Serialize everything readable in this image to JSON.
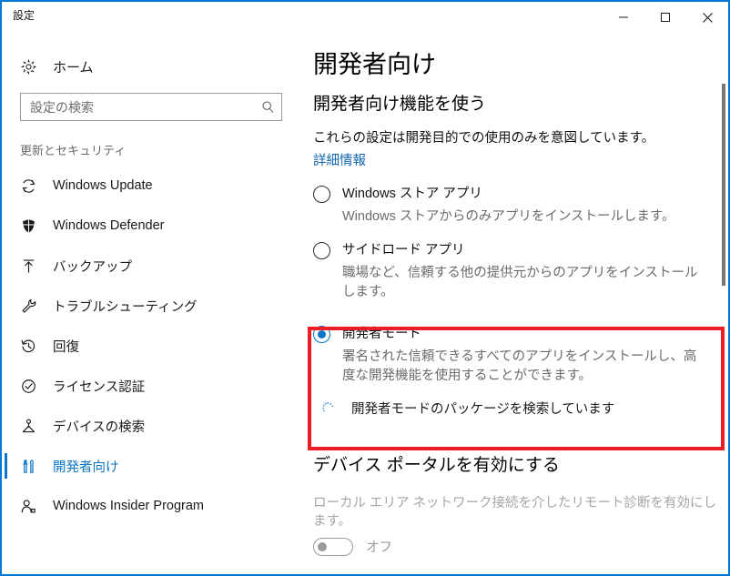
{
  "window": {
    "title": "設定",
    "accent_color": "#0078d7",
    "controls": [
      {
        "name": "minimize",
        "glyph": "minimize-icon"
      },
      {
        "name": "maximize",
        "glyph": "maximize-icon"
      },
      {
        "name": "close",
        "glyph": "close-icon"
      }
    ]
  },
  "sidebar": {
    "home": {
      "label": "ホーム",
      "icon": "gear-icon"
    },
    "search": {
      "value": "",
      "placeholder": "設定の検索",
      "icon": "search-icon"
    },
    "group_title": "更新とセキュリティ",
    "items": [
      {
        "label": "Windows Update",
        "icon": "refresh-icon",
        "selected": false
      },
      {
        "label": "Windows Defender",
        "icon": "shield-icon",
        "selected": false
      },
      {
        "label": "バックアップ",
        "icon": "upload-arrow-icon",
        "selected": false
      },
      {
        "label": "トラブルシューティング",
        "icon": "wrench-icon",
        "selected": false
      },
      {
        "label": "回復",
        "icon": "history-clock-icon",
        "selected": false
      },
      {
        "label": "ライセンス認証",
        "icon": "check-circle-icon",
        "selected": false
      },
      {
        "label": "デバイスの検索",
        "icon": "device-locate-icon",
        "selected": false
      },
      {
        "label": "開発者向け",
        "icon": "dev-tools-icon",
        "selected": true
      },
      {
        "label": "Windows Insider Program",
        "icon": "person-badge-icon",
        "selected": false
      }
    ],
    "selected_color": "#0b76c8"
  },
  "main": {
    "page_title": "開発者向け",
    "section_heading": "開発者向け機能を使う",
    "description": "これらの設定は開発目的での使用のみを意図しています。",
    "learn_more_link": "詳細情報",
    "link_color": "#1267b5",
    "options": [
      {
        "label": "Windows ストア アプリ",
        "description": "Windows ストアからのみアプリをインストールします。",
        "selected": false
      },
      {
        "label": "サイドロード アプリ",
        "description": "職場など、信頼する他の提供元からのアプリをインストールします。",
        "selected": false
      },
      {
        "label": "開発者モード",
        "description": "署名された信頼できるすべてのアプリをインストールし、高度な開発機能を使用することができます。",
        "selected": true,
        "status": {
          "text": "開発者モードのパッケージを検索しています",
          "icon": "loading-spinner-icon"
        }
      }
    ],
    "highlight_color": "#ee1c25",
    "device_portal": {
      "heading": "デバイス ポータルを有効にする",
      "description": "ローカル エリア ネットワーク接続を介したリモート診断を有効にします。",
      "toggle": {
        "state_label": "オフ",
        "on": false,
        "enabled": false
      }
    }
  }
}
